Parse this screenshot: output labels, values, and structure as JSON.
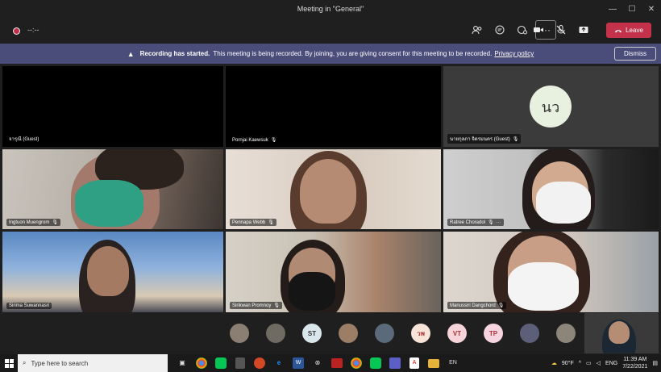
{
  "window": {
    "title": "Meeting in \"General\"",
    "minimize": "—",
    "maximize": "☐",
    "close": "✕"
  },
  "toolbar": {
    "timer": "--:--",
    "participants_icon": "people-icon",
    "chat_icon": "chat-icon",
    "reactions_icon": "reactions-icon",
    "more_label": "···",
    "camera_icon": "camera-icon",
    "mic_icon": "mic-off-icon",
    "share_icon": "share-icon",
    "leave_label": "Leave"
  },
  "banner": {
    "title": "Recording has started.",
    "message": "This meeting is being recorded. By joining, you are giving consent for this meeting to be recorded.",
    "policy_link": "Privacy policy",
    "dismiss_label": "Dismiss"
  },
  "tiles": [
    {
      "name": "จารุณี (Guest)"
    },
    {
      "name": "Pornjai Kaewsuk"
    },
    {
      "name": "นายกุลภา จิตรมนตร (Guest)",
      "initials": "นว"
    },
    {
      "name": "Ingtuon Muengrom"
    },
    {
      "name": "Pennapa Webb"
    },
    {
      "name": "Ratree Choradol"
    },
    {
      "name": "Sirima Suwannasri"
    },
    {
      "name": "Sirikwan Promnoy"
    },
    {
      "name": "Manussiri Dangchord"
    }
  ],
  "strip": [
    {
      "initials": "",
      "color": "#8a7f72"
    },
    {
      "initials": "",
      "color": "#6f6a62"
    },
    {
      "initials": "ST",
      "color": "#d9e6ec"
    },
    {
      "initials": "",
      "color": "#9c7d66"
    },
    {
      "initials": "",
      "color": "#5a6a7a"
    },
    {
      "initials": "วพ",
      "color": "#f7e3d8"
    },
    {
      "initials": "VT",
      "color": "#f6d4d9"
    },
    {
      "initials": "TP",
      "color": "#f6d4e0"
    },
    {
      "initials": "",
      "color": "#5d5f78"
    },
    {
      "initials": "",
      "color": "#8c8579"
    }
  ],
  "taskbar": {
    "search_placeholder": "Type here to search",
    "weather": "90°F",
    "lang": "ENG",
    "time": "11:39 AM",
    "date": "7/22/2021",
    "lang_short": "EN"
  }
}
